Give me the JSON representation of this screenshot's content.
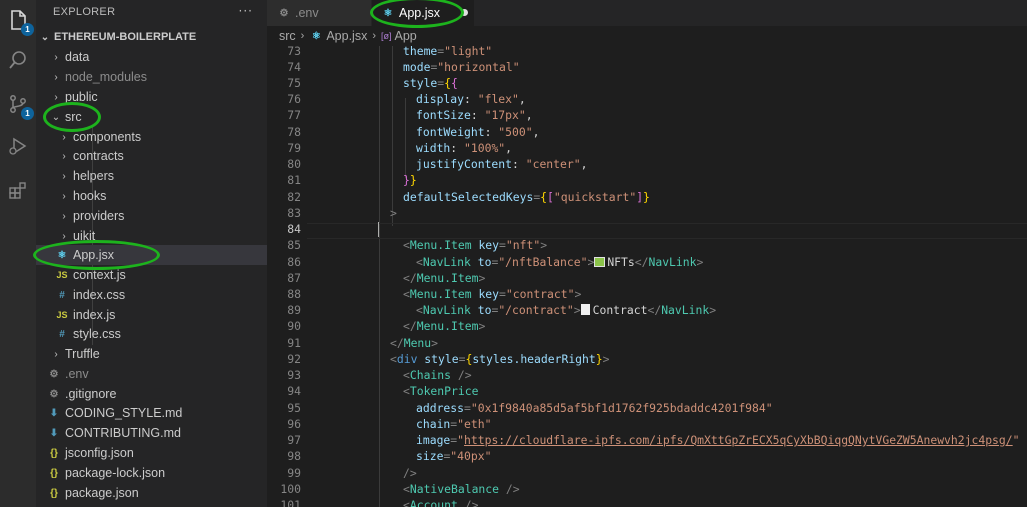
{
  "activity_bar": {
    "items": [
      {
        "icon": "files-icon",
        "badge": "1"
      },
      {
        "icon": "search-icon"
      },
      {
        "icon": "source-control-icon",
        "badge": "1"
      },
      {
        "icon": "run-debug-icon"
      },
      {
        "icon": "extensions-icon"
      }
    ]
  },
  "sidebar": {
    "title": "EXPLORER",
    "more": "···",
    "project": "ETHEREUM-BOILERPLATE",
    "items": [
      {
        "label": "data",
        "type": "folder"
      },
      {
        "label": "node_modules",
        "type": "folder"
      },
      {
        "label": "public",
        "type": "folder"
      },
      {
        "label": "src",
        "type": "folder-open"
      },
      {
        "label": "components",
        "type": "folder"
      },
      {
        "label": "contracts",
        "type": "folder"
      },
      {
        "label": "helpers",
        "type": "folder"
      },
      {
        "label": "hooks",
        "type": "folder"
      },
      {
        "label": "providers",
        "type": "folder"
      },
      {
        "label": "uikit",
        "type": "folder"
      },
      {
        "label": "App.jsx",
        "type": "react"
      },
      {
        "label": "context.js",
        "type": "js"
      },
      {
        "label": "index.css",
        "type": "css"
      },
      {
        "label": "index.js",
        "type": "js"
      },
      {
        "label": "style.css",
        "type": "css"
      },
      {
        "label": "Truffle",
        "type": "folder"
      },
      {
        "label": ".env",
        "type": "gear"
      },
      {
        "label": ".gitignore",
        "type": "gear"
      },
      {
        "label": "CODING_STYLE.md",
        "type": "md"
      },
      {
        "label": "CONTRIBUTING.md",
        "type": "md"
      },
      {
        "label": "jsconfig.json",
        "type": "json"
      },
      {
        "label": "package-lock.json",
        "type": "json"
      },
      {
        "label": "package.json",
        "type": "json"
      }
    ]
  },
  "tabs": [
    {
      "label": ".env",
      "active": false
    },
    {
      "label": "App.jsx",
      "active": true
    }
  ],
  "breadcrumb": {
    "folder": "src",
    "file": "App.jsx",
    "symbol": "App",
    "symbol_icon": "[ø]"
  },
  "editor": {
    "current_line": "84",
    "lines": {
      "l73": "73",
      "l74": "74",
      "l75": "75",
      "l76": "76",
      "l77": "77",
      "l78": "78",
      "l79": "79",
      "l80": "80",
      "l81": "81",
      "l82": "82",
      "l83": "83",
      "l84": "84",
      "l85": "85",
      "l86": "86",
      "l87": "87",
      "l88": "88",
      "l89": "89",
      "l90": "90",
      "l91": "91",
      "l92": "92",
      "l93": "93",
      "l94": "94",
      "l95": "95",
      "l96": "96",
      "l97": "97",
      "l98": "98",
      "l99": "99",
      "l100": "100",
      "l101": "101"
    },
    "code": {
      "theme_attr": "theme",
      "theme_val": "\"light\"",
      "mode_attr": "mode",
      "mode_val": "\"horizontal\"",
      "style_attr": "style",
      "display_k": "display",
      "display_v": "\"flex\"",
      "fontSize_k": "fontSize",
      "fontSize_v": "\"17px\"",
      "fontWeight_k": "fontWeight",
      "fontWeight_v": "\"500\"",
      "width_k": "width",
      "width_v": "\"100%\"",
      "justify_k": "justifyContent",
      "justify_v": "\"center\"",
      "dsk_attr": "defaultSelectedKeys",
      "dsk_val": "\"quickstart\"",
      "menu_item": "Menu.Item",
      "key_attr": "key",
      "nft_val": "\"nft\"",
      "navlink": "NavLink",
      "to_attr": "to",
      "nft_to": "\"/nftBalance\"",
      "nft_text": "NFTs",
      "contract_val": "\"contract\"",
      "contract_to": "\"/contract\"",
      "contract_text": "Contract",
      "menu": "Menu",
      "div": "div",
      "styles_ref": "styles.headerRight",
      "chains": "Chains",
      "token_price": "TokenPrice",
      "address_attr": "address",
      "address_val": "\"0x1f9840a85d5af5bf1d1762f925bdaddc4201f984\"",
      "chain_attr": "chain",
      "chain_val": "\"eth\"",
      "image_attr": "image",
      "image_val": "https://cloudflare-ipfs.com/ipfs/QmXttGpZrECX5qCyXbBQiqgQNytVGeZW5Anewvh2jc4psg/",
      "size_attr": "size",
      "size_val": "\"40px\"",
      "native_balance": "NativeBalance",
      "account": "Account"
    }
  }
}
